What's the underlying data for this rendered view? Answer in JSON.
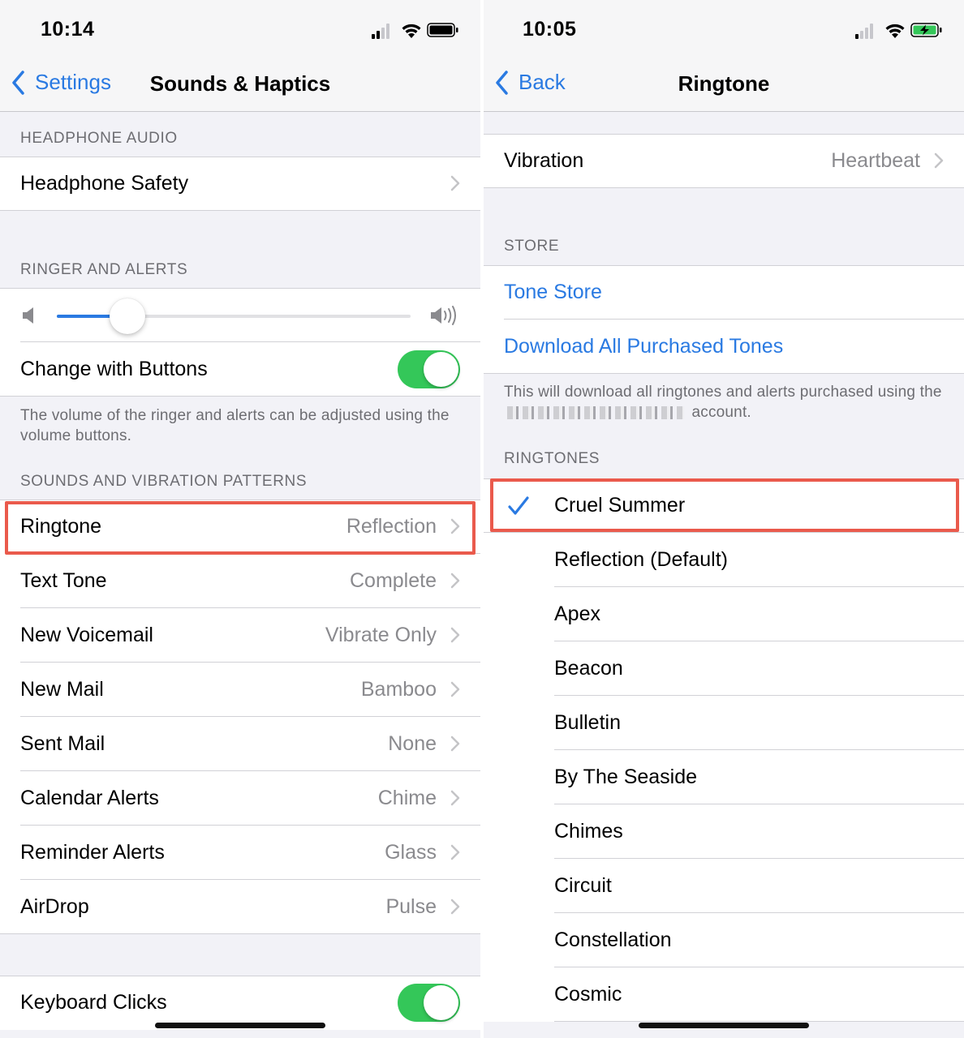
{
  "left": {
    "status": {
      "time": "10:14"
    },
    "nav": {
      "back_label": "Settings",
      "title": "Sounds & Haptics"
    },
    "headphone_audio": {
      "header": "HEADPHONE AUDIO",
      "safety_label": "Headphone Safety"
    },
    "ringer": {
      "header": "RINGER AND ALERTS",
      "volume_level": 0.2,
      "change_with_buttons_label": "Change with Buttons",
      "change_with_buttons_on": true,
      "footer": "The volume of the ringer and alerts can be adjusted using the volume buttons."
    },
    "sounds": {
      "header": "SOUNDS AND VIBRATION PATTERNS",
      "items": [
        {
          "label": "Ringtone",
          "value": "Reflection"
        },
        {
          "label": "Text Tone",
          "value": "Complete"
        },
        {
          "label": "New Voicemail",
          "value": "Vibrate Only"
        },
        {
          "label": "New Mail",
          "value": "Bamboo"
        },
        {
          "label": "Sent Mail",
          "value": "None"
        },
        {
          "label": "Calendar Alerts",
          "value": "Chime"
        },
        {
          "label": "Reminder Alerts",
          "value": "Glass"
        },
        {
          "label": "AirDrop",
          "value": "Pulse"
        }
      ]
    },
    "keyboard_clicks": {
      "label": "Keyboard Clicks",
      "on": true
    }
  },
  "right": {
    "status": {
      "time": "10:05"
    },
    "nav": {
      "back_label": "Back",
      "title": "Ringtone"
    },
    "vibration": {
      "label": "Vibration",
      "value": "Heartbeat"
    },
    "store": {
      "header": "STORE",
      "tone_store": "Tone Store",
      "download_all": "Download All Purchased Tones",
      "footer_prefix": "This will download all ringtones and alerts purchased using the",
      "footer_suffix": "account."
    },
    "ringtones": {
      "header": "RINGTONES",
      "selected": "Cruel Summer",
      "items": [
        "Cruel Summer",
        "Reflection (Default)",
        "Apex",
        "Beacon",
        "Bulletin",
        "By The Seaside",
        "Chimes",
        "Circuit",
        "Constellation",
        "Cosmic"
      ]
    }
  },
  "colors": {
    "accent": "#2a7ae2",
    "toggle_on": "#34c759",
    "highlight": "#ea5a4c"
  },
  "icons": [
    "cellular-signal-icon",
    "wifi-icon",
    "battery-icon",
    "battery-charging-icon",
    "chevron-left-icon",
    "chevron-right-icon",
    "speaker-low-icon",
    "speaker-high-icon",
    "checkmark-icon"
  ]
}
